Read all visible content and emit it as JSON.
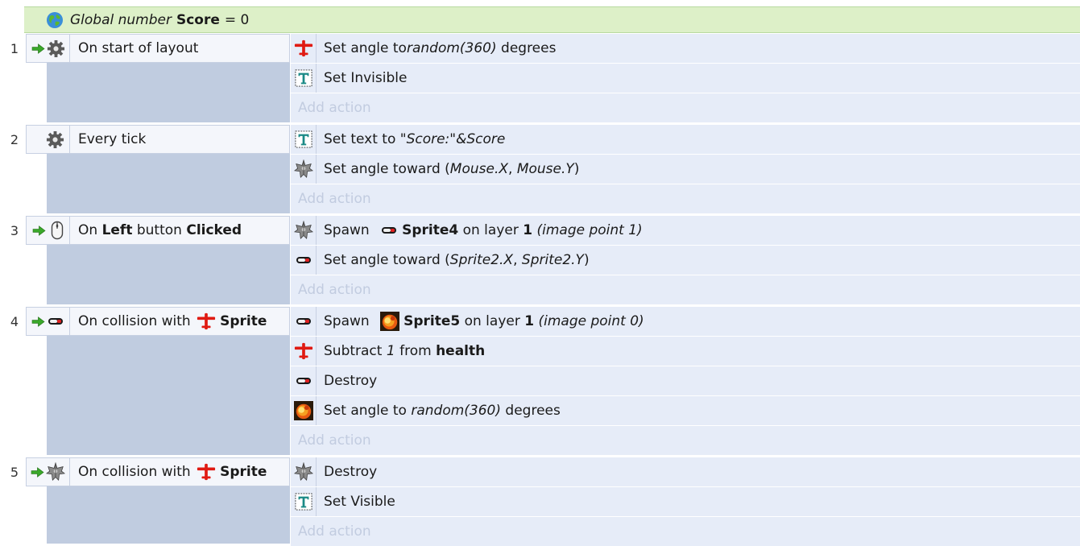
{
  "global": {
    "keyword": "Global number",
    "name": "Score",
    "value": "= 0"
  },
  "add_action_label": "Add action",
  "events": [
    {
      "number": "1",
      "condition": {
        "text": "On start of layout"
      },
      "actions": [
        {
          "pre": "Set angle to ",
          "italic": "random(360)",
          "post": " degrees"
        },
        {
          "text": "Set Invisible"
        }
      ]
    },
    {
      "number": "2",
      "condition": {
        "text": "Every tick"
      },
      "actions": [
        {
          "pre": "Set text to ",
          "italic": "\"Score:\"&Score"
        },
        {
          "pre": "Set angle toward (",
          "italic1": "Mouse.X",
          "mid": ", ",
          "italic2": "Mouse.Y",
          "post": ")"
        }
      ]
    },
    {
      "number": "3",
      "condition": {
        "pre": "On ",
        "b1": "Left",
        "mid": " button ",
        "b2": "Clicked"
      },
      "actions": [
        {
          "pre": "Spawn ",
          "obj": "Sprite4",
          "mid": " on layer ",
          "layer": "1",
          "italic": " (image point 1)"
        },
        {
          "pre": "Set angle toward (",
          "italic1": "Sprite2.X",
          "mid": ", ",
          "italic2": "Sprite2.Y",
          "post": ")"
        }
      ]
    },
    {
      "number": "4",
      "condition": {
        "pre": "On collision with ",
        "obj": "Sprite"
      },
      "actions": [
        {
          "pre": "Spawn ",
          "obj": "Sprite5",
          "mid": " on layer ",
          "layer": "1",
          "italic": " (image point 0)"
        },
        {
          "pre": "Subtract ",
          "italic": "1",
          "mid": " from ",
          "b": "health"
        },
        {
          "text": "Destroy"
        },
        {
          "pre": "Set angle to ",
          "italic": "random(360)",
          "post": " degrees"
        }
      ]
    },
    {
      "number": "5",
      "condition": {
        "pre": "On collision with ",
        "obj": "Sprite"
      },
      "actions": [
        {
          "text": "Destroy"
        },
        {
          "text": "Set Visible"
        }
      ]
    }
  ],
  "icons": {
    "globe": "globe-icon",
    "arrow": "green-arrow-icon",
    "system": "gear-icon",
    "mouse": "mouse-icon",
    "sprite": "red-plane-sprite-icon",
    "text": "text-object-icon",
    "sprite2": "grey-ship-sprite-icon",
    "sprite4": "bullet-sprite-icon",
    "sprite5": "explosion-sprite-icon"
  },
  "colors": {
    "global_bg": "#ddf0c8",
    "condition_bg": "#f4f6fb",
    "condition_fill": "#c0cce0",
    "action_bg": "#e6ecf8",
    "add_action_text": "#c2cce0"
  }
}
